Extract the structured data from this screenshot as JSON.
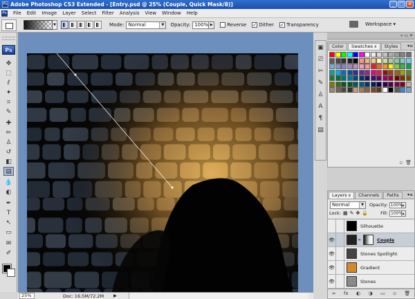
{
  "window": {
    "title": "Adobe Photoshop CS3 Extended - [Entry.psd @ 25% (Couple, Quick Mask/8)]",
    "app_badge": "Ps",
    "controls": [
      "_",
      "□",
      "✕"
    ]
  },
  "menu": [
    "File",
    "Edit",
    "Image",
    "Layer",
    "Select",
    "Filter",
    "Analysis",
    "View",
    "Window",
    "Help"
  ],
  "options": {
    "mode_label": "Mode:",
    "mode_value": "Normal",
    "opacity_label": "Opacity:",
    "opacity_value": "100%",
    "reverse_label": "Reverse",
    "reverse_checked": "",
    "dither_label": "Dither",
    "dither_checked": "✓",
    "transparency_label": "Transparency",
    "transparency_checked": "✓",
    "workspace_label": "Workspace ▾"
  },
  "tools": [
    "move-icon",
    "marquee-icon",
    "lasso-icon",
    "magic-wand-icon",
    "crop-icon",
    "eyedropper-icon",
    "healing-icon",
    "brush-icon",
    "clone-stamp-icon",
    "history-brush-icon",
    "eraser-icon",
    "gradient-icon",
    "blur-icon",
    "dodge-icon",
    "pen-icon",
    "type-icon",
    "path-select-icon",
    "shape-icon",
    "notes-icon",
    "eyedropper2-icon",
    "hand-icon",
    "zoom-icon"
  ],
  "tool_glyphs": [
    "✥",
    "⬚",
    "ℓ",
    "✦",
    "⌗",
    "✎",
    "✚",
    "✏",
    "♙",
    "↺",
    "◧",
    "▤",
    "💧",
    "◐",
    "✒",
    "T",
    "↖",
    "▭",
    "✉",
    "✐",
    "✋",
    "🔍"
  ],
  "status": {
    "zoom": "25%",
    "doc": "Doc: 16.5M/72.2M",
    "arrow": "▶"
  },
  "swatches_panel": {
    "tabs": [
      "Color",
      "Swatches",
      "Styles"
    ],
    "active_tab": "Swatches",
    "tab_close": "x",
    "colors": [
      "#ff0000",
      "#ffff00",
      "#00ff00",
      "#00ffff",
      "#0000ff",
      "#ff00ff",
      "#ffffff",
      "#ebebeb",
      "#d6d6d6",
      "#c2c2c2",
      "#adadad",
      "#999999",
      "#858585",
      "#707070",
      "#5c5c5c",
      "#474747",
      "#333333",
      "#1f1f1f",
      "#000000",
      "#f7977a",
      "#f9ad81",
      "#fdc68a",
      "#fff79a",
      "#c4df9b",
      "#a2d39c",
      "#82ca9d",
      "#7bcdc8",
      "#6ecff6",
      "#7ea7d8",
      "#8493ca",
      "#8882be",
      "#a187be",
      "#bc8dbf",
      "#f49ac2",
      "#f6989d",
      "#ed1c24",
      "#f26522",
      "#f7941d",
      "#fff200",
      "#8dc63f",
      "#39b54a",
      "#00a651",
      "#00a99d",
      "#00aeef",
      "#0072bc",
      "#0054a6",
      "#2e3192",
      "#662d91",
      "#92278f",
      "#ec008c",
      "#ed145b",
      "#9e0b0f",
      "#a0410d",
      "#a3620a",
      "#aba000",
      "#598527",
      "#1a7b30",
      "#007236",
      "#00746b",
      "#0076a3",
      "#004a80",
      "#003471",
      "#1b1464",
      "#440e62",
      "#630460",
      "#9e005d",
      "#9e0039",
      "#790000",
      "#7b2e00",
      "#7d4900",
      "#827b00",
      "#406618",
      "#005e20",
      "#005826",
      "#005952",
      "#005b7f",
      "#003663",
      "#002157",
      "#0d004c",
      "#32004b",
      "#4b0049",
      "#7b0046",
      "#7a0026",
      "#c7b299",
      "#998675",
      "#736357",
      "#534741",
      "#37302d",
      "#c69c6d",
      "#a67c52",
      "#8c6239",
      "#754c24",
      "#603913",
      "#ffffff",
      "#000000",
      "#5c5c5c",
      "#3e89c8",
      "#68a8dd"
    ],
    "footer_icons": [
      "new-swatch-icon",
      "trash-icon"
    ],
    "footer_glyphs": [
      "▫",
      "🗑"
    ]
  },
  "layers_panel": {
    "tabs": [
      "Layers",
      "Channels",
      "Paths"
    ],
    "active_tab": "Layers",
    "tab_close": "x",
    "blend_mode": "Normal",
    "opacity_label": "Opacity:",
    "opacity_value": "100%",
    "lock_label": "Lock:",
    "fill_label": "Fill:",
    "fill_value": "100%",
    "layers": [
      {
        "name": "Silhouette",
        "visible": "",
        "selected": "false",
        "thumb": "#000000",
        "mask": "",
        "bold": "false"
      },
      {
        "name": "Couple",
        "visible": "👁",
        "selected": "true",
        "thumb": "#222222",
        "mask": "#e9e9e9",
        "bold": "true"
      },
      {
        "name": "Stones Spotlight",
        "visible": "👁",
        "selected": "false",
        "thumb": "#444444",
        "mask": "",
        "bold": "false"
      },
      {
        "name": "Gradient",
        "visible": "👁",
        "selected": "false",
        "thumb": "#d38a2a",
        "mask": "",
        "bold": "false"
      },
      {
        "name": "Stones",
        "visible": "👁",
        "selected": "false",
        "thumb": "#8a8a8a",
        "mask": "",
        "bold": "false"
      }
    ],
    "footer_glyphs": [
      "∞",
      "fx",
      "◐",
      "◑",
      "▭",
      "▫",
      "🗑"
    ]
  },
  "colors": {
    "canvas_bg": "#050505",
    "workarea_bg": "#6c8fbd",
    "fg_color": "#000000",
    "bg_color": "#ffffff",
    "accent": "#2f6fcf"
  }
}
